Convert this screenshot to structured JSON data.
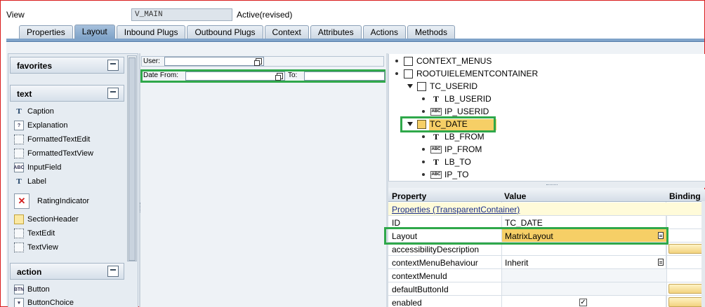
{
  "header": {
    "view_label": "View",
    "view_name": "V_MAIN",
    "status": "Active(revised)"
  },
  "tabs": [
    {
      "label": "Properties"
    },
    {
      "label": "Layout",
      "active": true
    },
    {
      "label": "Inbound Plugs"
    },
    {
      "label": "Outbound Plugs"
    },
    {
      "label": "Context"
    },
    {
      "label": "Attributes"
    },
    {
      "label": "Actions"
    },
    {
      "label": "Methods"
    }
  ],
  "palette": {
    "favorites": {
      "title": "favorites"
    },
    "text": {
      "title": "text",
      "items": [
        {
          "label": "Caption",
          "icon": "caption-icon"
        },
        {
          "label": "Explanation",
          "icon": "explanation-icon"
        },
        {
          "label": "FormattedTextEdit",
          "icon": "formatted-text-edit-icon"
        },
        {
          "label": "FormattedTextView",
          "icon": "formatted-text-view-icon"
        },
        {
          "label": "InputField",
          "icon": "input-field-icon"
        },
        {
          "label": "Label",
          "icon": "label-icon"
        },
        {
          "label": "RatingIndicator",
          "icon": "rating-indicator-icon"
        },
        {
          "label": "SectionHeader",
          "icon": "section-header-icon"
        },
        {
          "label": "TextEdit",
          "icon": "text-edit-icon"
        },
        {
          "label": "TextView",
          "icon": "text-view-icon"
        }
      ]
    },
    "action": {
      "title": "action",
      "items": [
        {
          "label": "Button",
          "icon": "button-icon"
        },
        {
          "label": "ButtonChoice",
          "icon": "button-choice-icon"
        }
      ]
    }
  },
  "canvas": {
    "user_label": "User:",
    "date_from_label": "Date From:",
    "to_label": "To:"
  },
  "tree": [
    {
      "label": "CONTEXT_MENUS",
      "level": 0
    },
    {
      "label": "ROOTUIELEMENTCONTAINER",
      "level": 0
    },
    {
      "label": "TC_USERID",
      "level": 1
    },
    {
      "label": "LB_USERID",
      "level": 2
    },
    {
      "label": "IP_USERID",
      "level": 2
    },
    {
      "label": "TC_DATE",
      "level": 1,
      "selected": true
    },
    {
      "label": "LB_FROM",
      "level": 2
    },
    {
      "label": "IP_FROM",
      "level": 2
    },
    {
      "label": "LB_TO",
      "level": 2
    },
    {
      "label": "IP_TO",
      "level": 2
    }
  ],
  "properties": {
    "col_property": "Property",
    "col_value": "Value",
    "col_binding": "Binding",
    "section": "Properties (TransparentContainer)",
    "rows": [
      {
        "name": "ID",
        "value": "TC_DATE"
      },
      {
        "name": "Layout",
        "value": "MatrixLayout"
      },
      {
        "name": "accessibilityDescription",
        "value": ""
      },
      {
        "name": "contextMenuBehaviour",
        "value": "Inherit"
      },
      {
        "name": "contextMenuId",
        "value": ""
      },
      {
        "name": "defaultButtonId",
        "value": ""
      },
      {
        "name": "enabled",
        "value": "",
        "checked": true
      }
    ]
  },
  "colors": {
    "highlight": "#2fa84a",
    "selected": "#f6cf66",
    "tab_active": "#7fa3c9"
  }
}
